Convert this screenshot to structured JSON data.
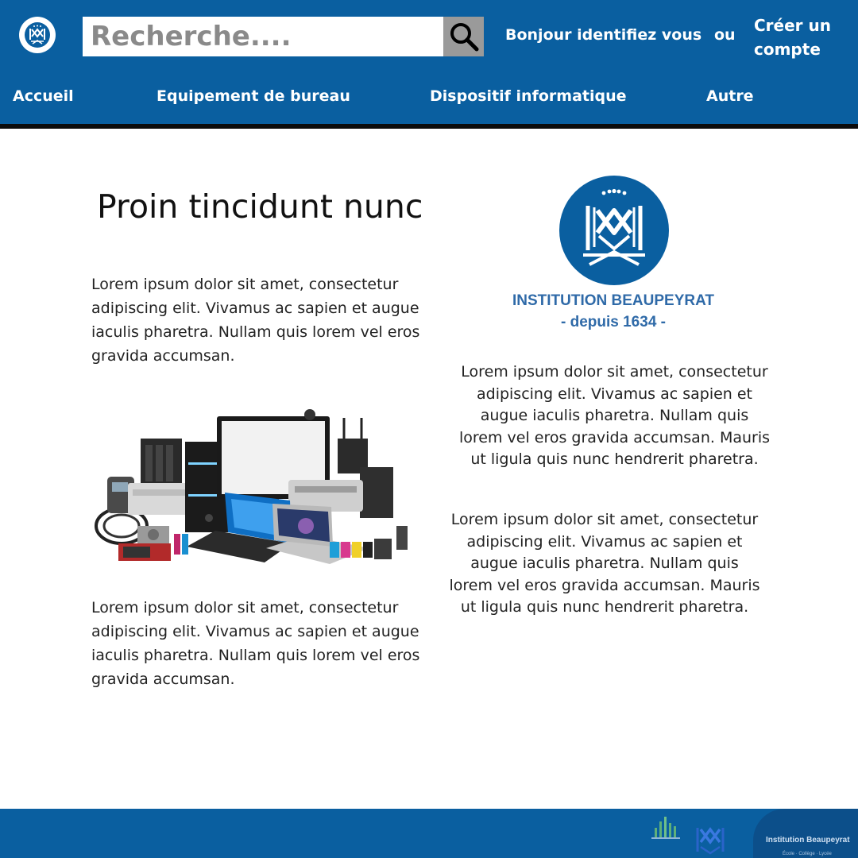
{
  "header": {
    "search_placeholder": "Recherche....",
    "search_icon": "magnifier-icon",
    "greeting": "Bonjour identifiez vous",
    "or": "ou",
    "create_account": "Créer un compte"
  },
  "nav": {
    "items": [
      {
        "label": "Accueil"
      },
      {
        "label": "Equipement de bureau"
      },
      {
        "label": "Dispositif informatique"
      },
      {
        "label": "Autre"
      }
    ]
  },
  "main": {
    "title": "Proin tincidunt nunc",
    "left_paragraph_1": "Lorem ipsum dolor sit amet, consectetur adipiscing elit. Vivamus ac sapien et augue iaculis pharetra. Nullam quis lorem vel eros gravida accumsan.",
    "left_paragraph_2": "Lorem ipsum dolor sit amet, consectetur adipiscing elit. Vivamus ac sapien et augue iaculis pharetra. Nullam quis lorem vel eros gravida accumsan.",
    "brand_name": "INSTITUTION BEAUPEYRAT",
    "brand_since": "- depuis 1634 -",
    "right_paragraph_1": "Lorem ipsum dolor sit amet, consectetur adipiscing elit. Vivamus ac sapien et augue iaculis pharetra. Nullam quis lorem vel eros gravida accumsan. Mauris ut ligula quis nunc hendrerit pharetra.",
    "right_paragraph_2": "Lorem ipsum dolor sit amet, consectetur adipiscing elit. Vivamus ac sapien et augue iaculis pharetra. Nullam quis lorem vel eros gravida accumsan. Mauris ut ligula quis nunc hendrerit pharetra."
  },
  "footer": {
    "brand_name": "Institution Beaupeyrat",
    "brand_sub": "École · Collège · Lycée"
  },
  "colors": {
    "brand_blue": "#0a5fa0",
    "brand_text_blue": "#2f6aa8",
    "search_button_gray": "#9a9a9a"
  }
}
